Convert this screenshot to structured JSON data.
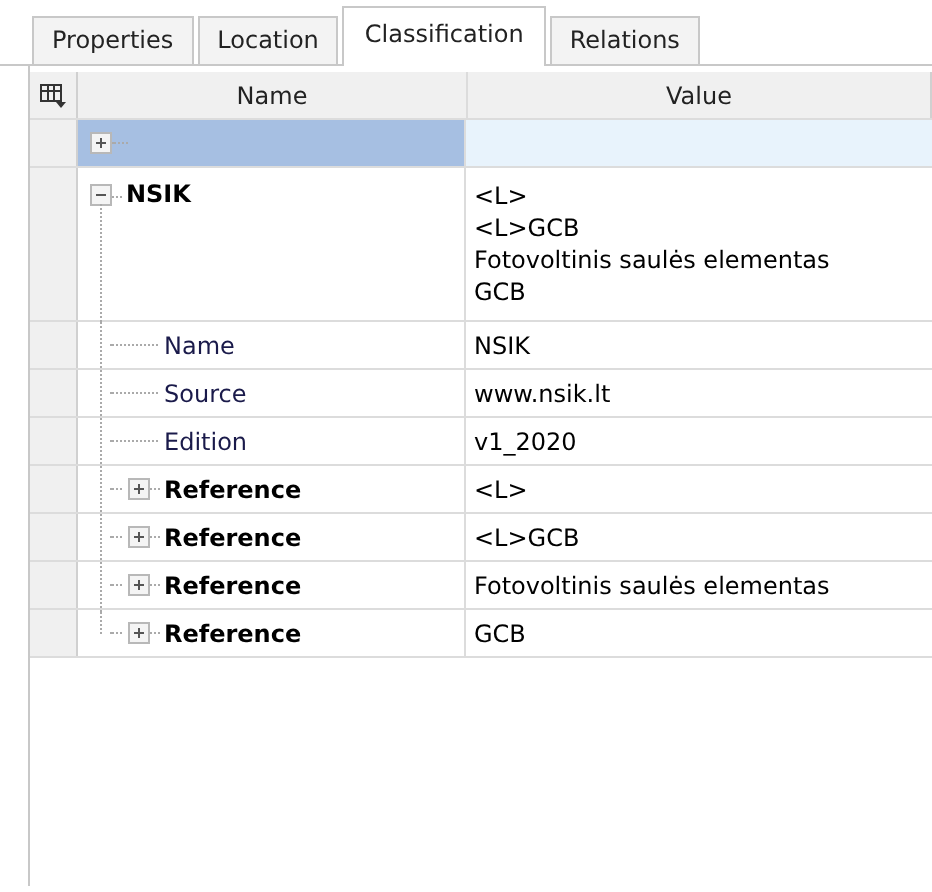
{
  "tabs": [
    {
      "label": "Properties",
      "selected": false
    },
    {
      "label": "Location",
      "selected": false
    },
    {
      "label": "Classification",
      "selected": true
    },
    {
      "label": "Relations",
      "selected": false
    }
  ],
  "grid": {
    "columns": [
      "Name",
      "Value"
    ],
    "new_row": {
      "selected": true,
      "expanded": false
    },
    "rows": [
      {
        "name": "NSIK",
        "value_lines": [
          "<L>",
          "<L>GCB",
          "Fotovoltinis saulės elementas",
          "GCB"
        ],
        "expanded": true,
        "selected": false,
        "children": [
          {
            "kind": "property",
            "name": "Name",
            "value": "NSIK",
            "selected": false
          },
          {
            "kind": "property",
            "name": "Source",
            "value": "www.nsik.lt",
            "selected": false
          },
          {
            "kind": "property",
            "name": "Edition",
            "value": "v1_2020",
            "selected": false
          },
          {
            "kind": "group",
            "name": "Reference",
            "value": "<L>",
            "expanded": false,
            "selected": false
          },
          {
            "kind": "group",
            "name": "Reference",
            "value": "<L>GCB",
            "expanded": false,
            "selected": false
          },
          {
            "kind": "group",
            "name": "Reference",
            "value": "Fotovoltinis saulės elementas",
            "expanded": false,
            "selected": false
          },
          {
            "kind": "group",
            "name": "Reference",
            "value": "GCB",
            "expanded": false,
            "selected": false
          }
        ]
      }
    ]
  }
}
